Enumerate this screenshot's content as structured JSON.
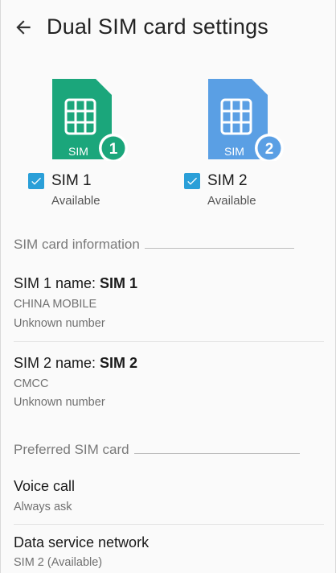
{
  "header": {
    "title": "Dual SIM card settings"
  },
  "colors": {
    "sim1_green": "#1ba67b",
    "sim2_blue": "#5a9fe4",
    "checkbox_blue": "#2a9fd8",
    "icon_white": "#ffffff"
  },
  "sims": [
    {
      "icon_label": "SIM",
      "badge": "1",
      "checkbox_label": "SIM 1",
      "status": "Available",
      "checked": true
    },
    {
      "icon_label": "SIM",
      "badge": "2",
      "checkbox_label": "SIM 2",
      "status": "Available",
      "checked": true
    }
  ],
  "sections": {
    "sim_info": "SIM card information",
    "preferred": "Preferred SIM card"
  },
  "sim_info_items": [
    {
      "name_prefix": "SIM 1 name: ",
      "name_value": "SIM 1",
      "carrier": "CHINA MOBILE",
      "number": "Unknown number"
    },
    {
      "name_prefix": "SIM 2 name: ",
      "name_value": "SIM 2",
      "carrier": "CMCC",
      "number": "Unknown number"
    }
  ],
  "preferred_items": [
    {
      "title": "Voice call",
      "value": "Always ask"
    },
    {
      "title": "Data service network",
      "value": "SIM 2 (Available)"
    }
  ]
}
